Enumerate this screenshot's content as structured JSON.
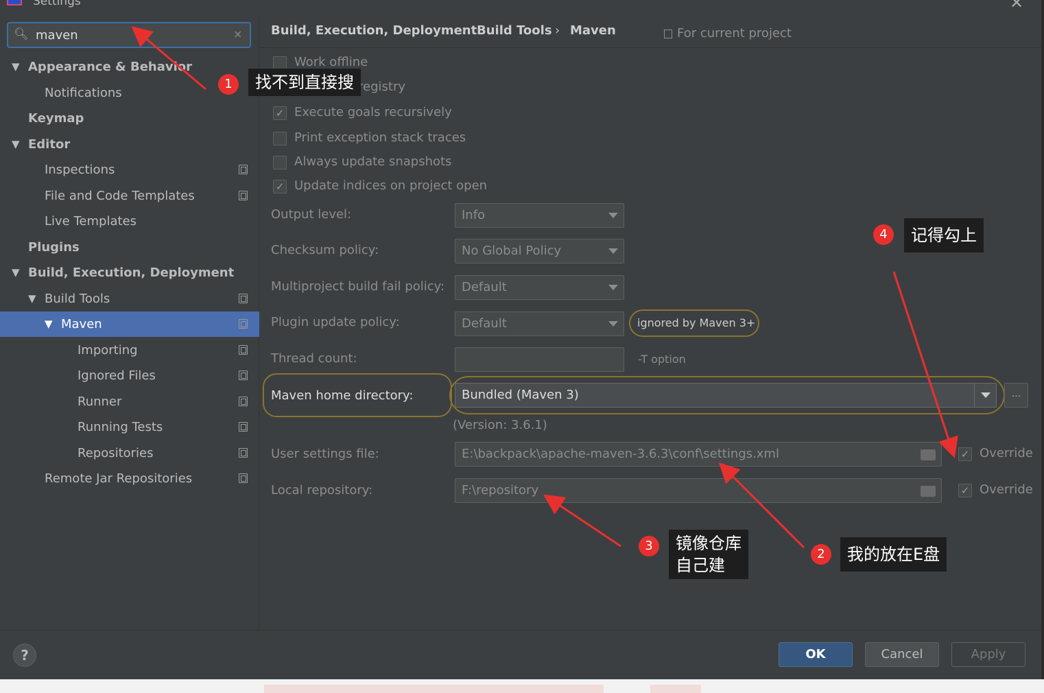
{
  "window": {
    "title": "Settings"
  },
  "search": {
    "value": "maven",
    "clear_symbol": "×"
  },
  "tree": [
    {
      "label": "Appearance & Behavior",
      "bold": true,
      "expanded": true,
      "has_copy": false
    },
    {
      "label": "Notifications",
      "bold": false,
      "has_copy": false
    },
    {
      "label": "Keymap",
      "bold": true,
      "has_copy": false
    },
    {
      "label": "Editor",
      "bold": true,
      "expanded": true,
      "has_copy": false
    },
    {
      "label": "Inspections",
      "bold": false,
      "has_copy": true
    },
    {
      "label": "File and Code Templates",
      "bold": false,
      "has_copy": true
    },
    {
      "label": "Live Templates",
      "bold": false,
      "has_copy": false
    },
    {
      "label": "Plugins",
      "bold": true,
      "has_copy": false
    },
    {
      "label": "Build, Execution, Deployment",
      "bold": true,
      "expanded": true,
      "has_copy": false
    },
    {
      "label": "Build Tools",
      "bold": false,
      "expanded": true,
      "has_copy": true
    },
    {
      "label": "Maven",
      "bold": false,
      "expanded": true,
      "selected": true,
      "has_copy": true
    },
    {
      "label": "Importing",
      "bold": false,
      "has_copy": true
    },
    {
      "label": "Ignored Files",
      "bold": false,
      "has_copy": true
    },
    {
      "label": "Runner",
      "bold": false,
      "has_copy": true
    },
    {
      "label": "Running Tests",
      "bold": false,
      "has_copy": true
    },
    {
      "label": "Repositories",
      "bold": false,
      "has_copy": true
    },
    {
      "label": "Remote Jar Repositories",
      "bold": false,
      "has_copy": true
    }
  ],
  "breadcrumb": {
    "items": [
      "Build, Execution, Deployment",
      "Build Tools",
      "Maven"
    ],
    "separator": "›",
    "project_label": "For current project"
  },
  "checkboxes": [
    {
      "label": "Work offline",
      "checked": false
    },
    {
      "label": "registry",
      "checked": false
    },
    {
      "label": "Execute goals recursively",
      "checked": true
    },
    {
      "label": "Print exception stack traces",
      "checked": false
    },
    {
      "label": "Always update snapshots",
      "checked": false
    },
    {
      "label": "Update indices on project open",
      "checked": true
    }
  ],
  "form": {
    "output_level": {
      "label": "Output level:",
      "value": "Info"
    },
    "checksum_policy": {
      "label": "Checksum policy:",
      "value": "No Global Policy"
    },
    "multiproject_policy": {
      "label": "Multiproject build fail policy:",
      "value": "Default"
    },
    "plugin_update_policy": {
      "label": "Plugin update policy:",
      "value": "Default",
      "note": "ignored by Maven 3+"
    },
    "thread_count": {
      "label": "Thread count:",
      "value": "",
      "note": "-T option"
    },
    "maven_home": {
      "label": "Maven home directory:",
      "value": "Bundled (Maven 3)",
      "version": "(Version: 3.6.1)",
      "browse": "..."
    },
    "user_settings": {
      "label": "User settings file:",
      "value": "E:\\backpack\\apache-maven-3.6.3\\conf\\settings.xml",
      "override_label": "Override",
      "override": true
    },
    "local_repo": {
      "label": "Local repository:",
      "value": "F:\\repository",
      "override_label": "Override",
      "override": true
    }
  },
  "footer": {
    "help": "?",
    "ok": "OK",
    "cancel": "Cancel",
    "apply": "Apply"
  },
  "annotations": [
    {
      "num": "1",
      "text": "找不到直接搜"
    },
    {
      "num": "2",
      "text": "我的放在E盘"
    },
    {
      "num": "3",
      "line1": "镜像仓库",
      "line2": "自己建"
    },
    {
      "num": "4",
      "text": "记得勾上"
    }
  ],
  "colors": {
    "accent": "#4b6eaf",
    "ok_button": "#365880",
    "annotation_red": "#e8302f",
    "highlight_outline": "#8a7430"
  }
}
